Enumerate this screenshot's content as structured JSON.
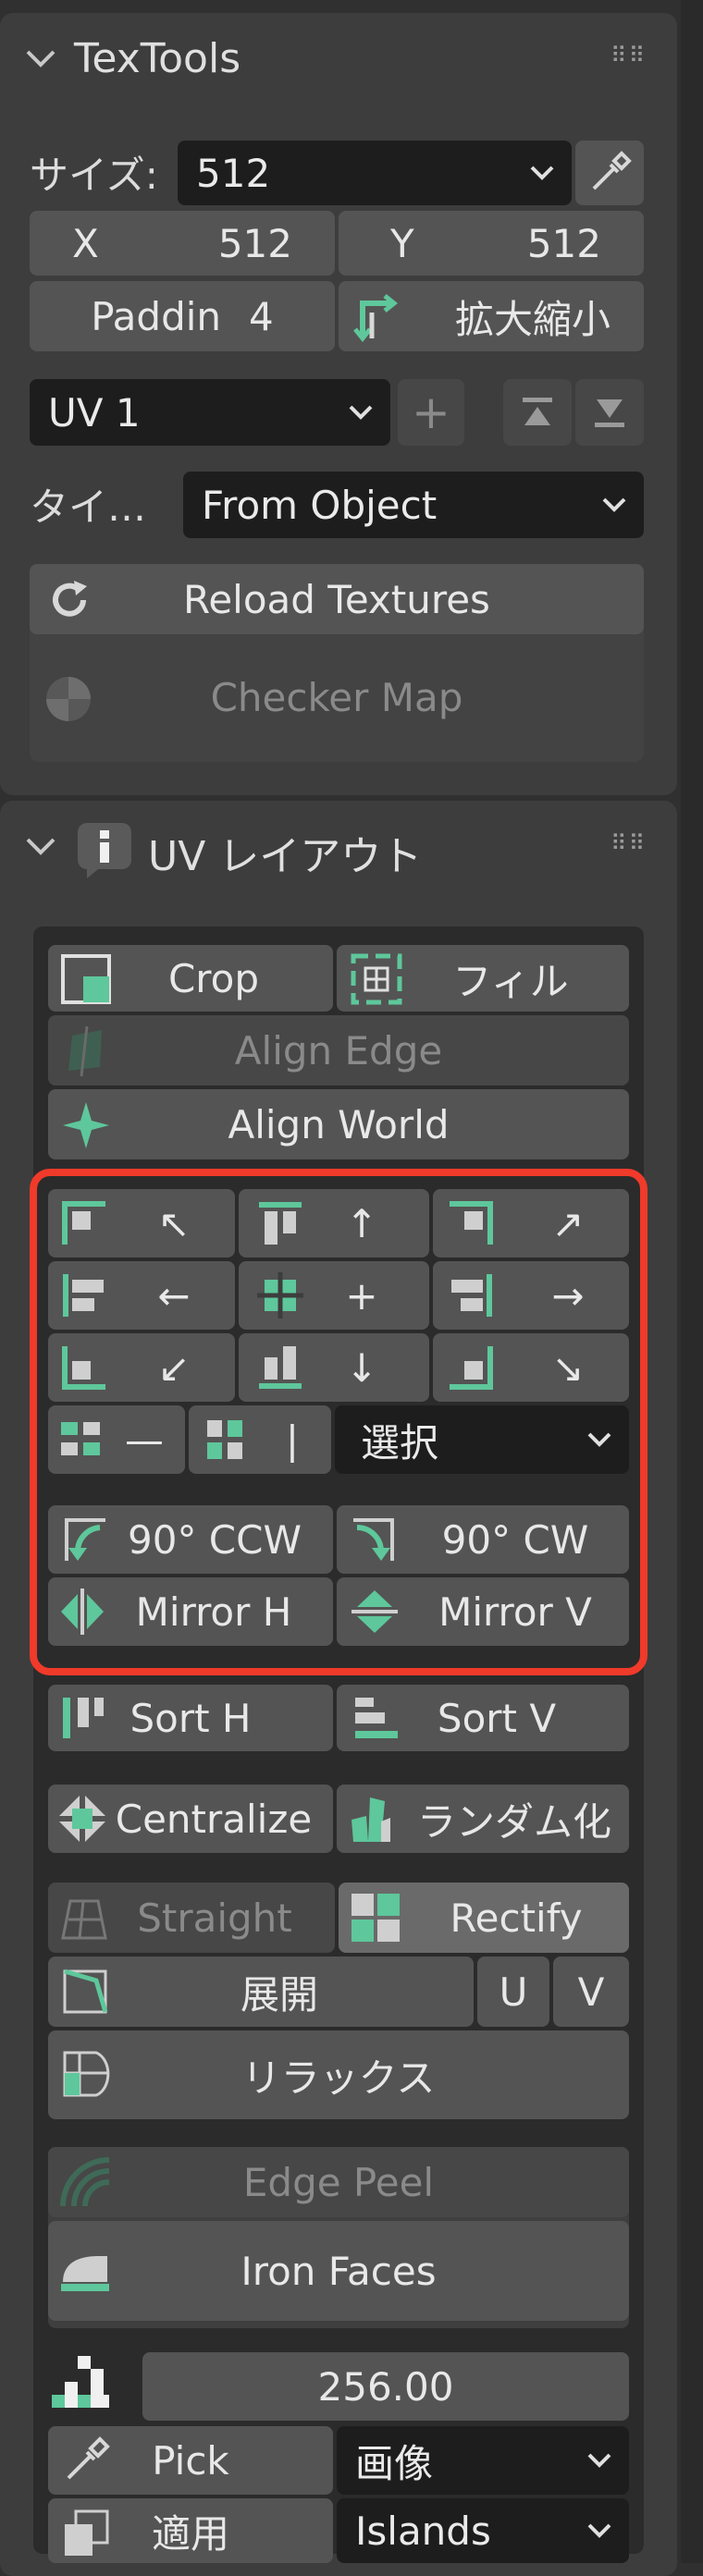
{
  "textools": {
    "title": "TexTools",
    "size_label": "サイズ:",
    "size_value": "512",
    "x_label": "X",
    "x_value": "512",
    "y_label": "Y",
    "y_value": "512",
    "padding_label": "Paddin",
    "padding_value": "4",
    "scale_label": "拡大縮小",
    "uv_channel": "UV 1",
    "plus": "+",
    "type_label": "タイ…",
    "type_value": "From Object",
    "reload_label": "Reload Textures",
    "checker_label": "Checker Map"
  },
  "uvlayout": {
    "title": "UV レイアウト",
    "crop_label": "Crop",
    "fill_label": "フィル",
    "align_edge_label": "Align Edge",
    "align_world_label": "Align World",
    "align_grid": [
      [
        "↖",
        "↑",
        "↗"
      ],
      [
        "←",
        "+",
        "→"
      ],
      [
        "↙",
        "↓",
        "↘"
      ]
    ],
    "dist_h": "—",
    "dist_v": "|",
    "select_value": "選択",
    "rot_ccw": "90° CCW",
    "rot_cw": "90° CW",
    "mirror_h": "Mirror H",
    "mirror_v": "Mirror V",
    "sort_h": "Sort H",
    "sort_v": "Sort V",
    "centralize": "Centralize",
    "randomize": "ランダム化",
    "straight": "Straight",
    "rectify": "Rectify",
    "unwrap": "展開",
    "u": "U",
    "v": "V",
    "relax": "リラックス",
    "edge_peel": "Edge Peel",
    "iron_faces": "Iron Faces",
    "texel_value": "256.00",
    "pick": "Pick",
    "pick_mode": "画像",
    "apply": "適用",
    "apply_mode": "Islands"
  },
  "colors": {
    "accent_green": "#5ec79b",
    "highlight_red": "#f03a2a"
  }
}
